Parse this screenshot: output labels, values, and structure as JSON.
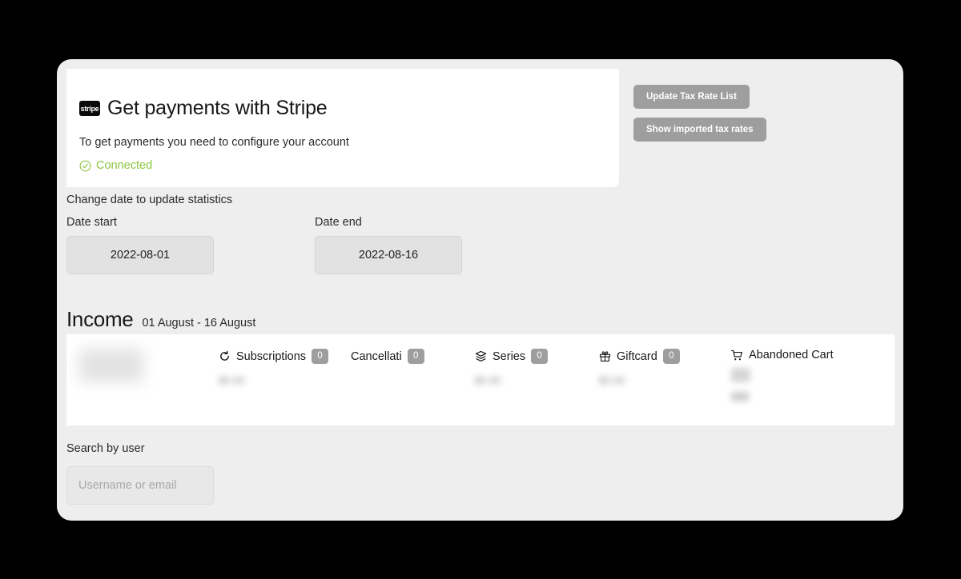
{
  "stripe_card": {
    "logo_text": "stripe",
    "title": "Get payments with Stripe",
    "subtitle": "To get payments you need to configure your account",
    "status_label": "Connected",
    "status_color": "#8cc63f"
  },
  "actions": {
    "update_tax_rate_list": "Update Tax Rate List",
    "show_imported_tax_rates": "Show imported tax rates",
    "button_color": "#9e9e9e"
  },
  "dates": {
    "section_label": "Change date to update statistics",
    "start_label": "Date start",
    "start_value": "2022-08-01",
    "end_label": "Date end",
    "end_value": "2022-08-16"
  },
  "income": {
    "title": "Income",
    "range": "01 August - 16 August",
    "stats": [
      {
        "key": "avatar",
        "label": "",
        "icon": "",
        "badge": "",
        "value": ""
      },
      {
        "key": "subscriptions",
        "label": "Subscriptions",
        "icon": "refresh-icon",
        "badge": "0",
        "value": "$0.00"
      },
      {
        "key": "cancellations",
        "label": "Cancellati",
        "icon": "",
        "badge": "0",
        "value": ""
      },
      {
        "key": "series",
        "label": "Series",
        "icon": "layers-icon",
        "badge": "0",
        "value": "$0.00"
      },
      {
        "key": "giftcard",
        "label": "Giftcard",
        "icon": "gift-icon",
        "badge": "0",
        "value": "$0.00"
      },
      {
        "key": "abandoned_cart",
        "label": "Abandoned Cart",
        "icon": "cart-icon",
        "badge": "",
        "value": ""
      }
    ]
  },
  "search": {
    "label": "Search by user",
    "placeholder": "Username or email",
    "value": ""
  }
}
